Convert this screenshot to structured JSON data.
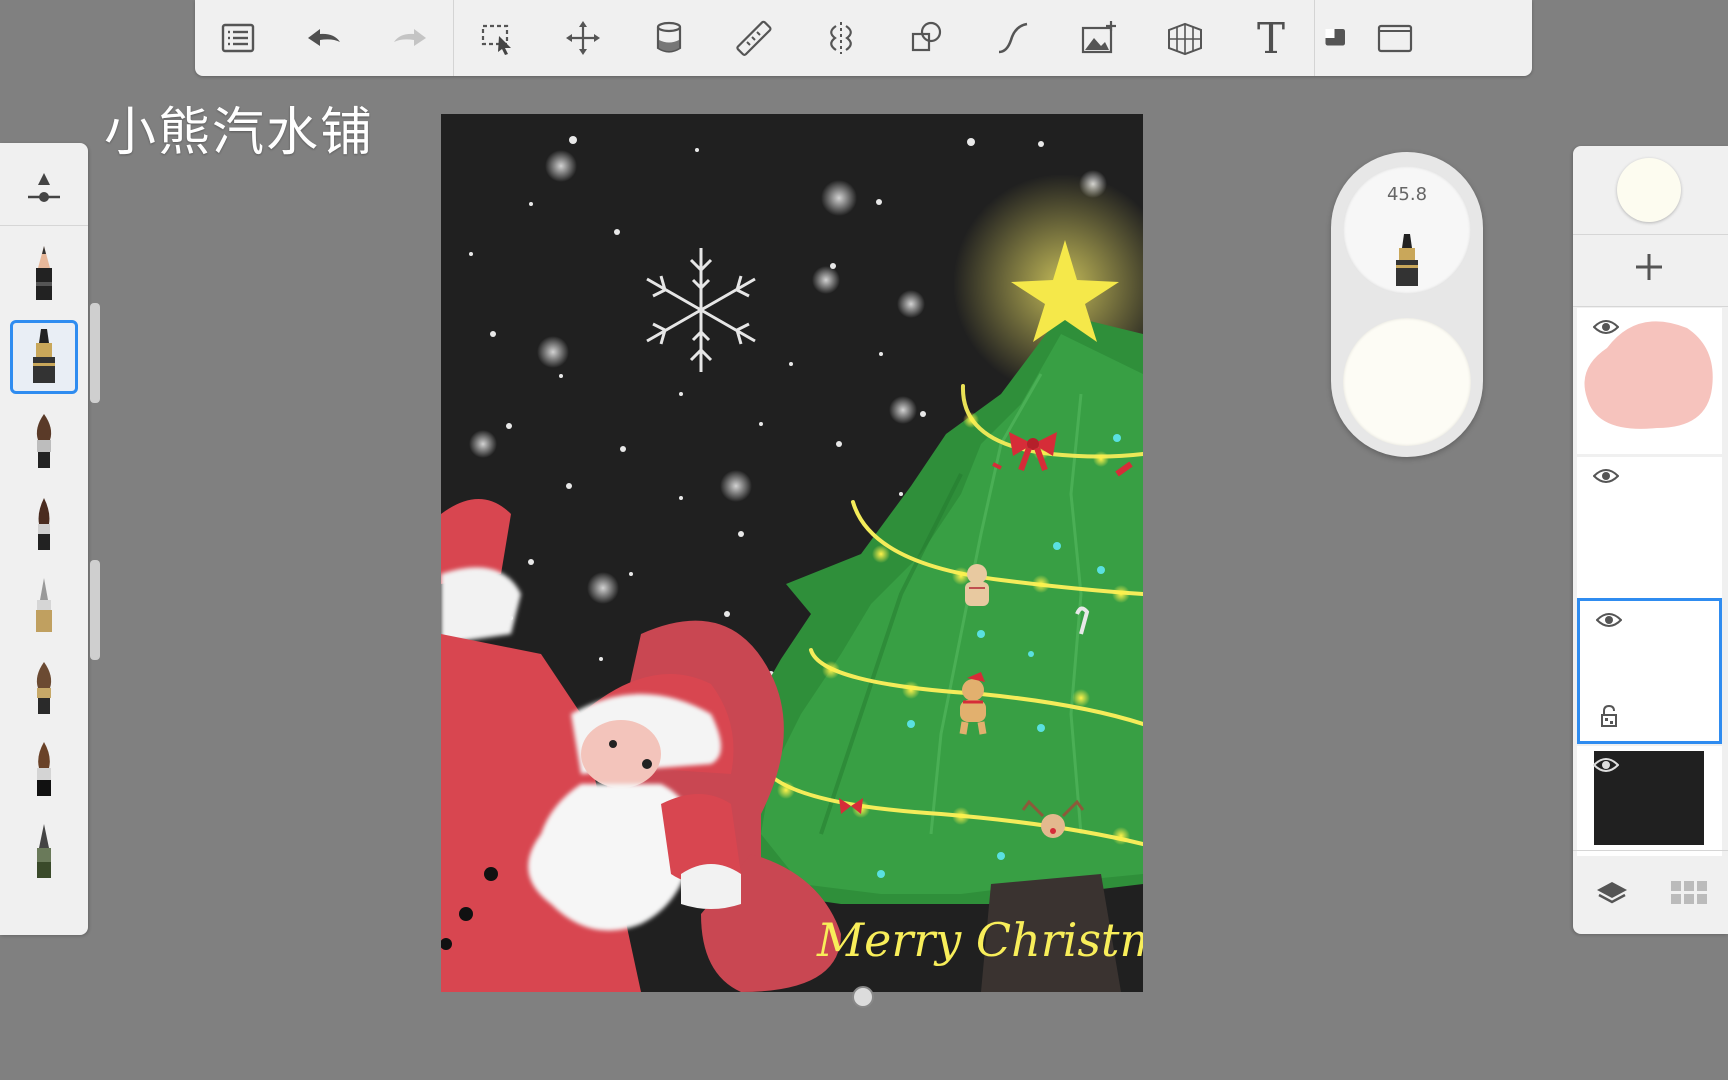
{
  "watermark": "小熊汽水铺",
  "toolbar": {
    "items": [
      {
        "name": "gallery-menu-icon"
      },
      {
        "name": "undo-icon"
      },
      {
        "name": "redo-icon"
      },
      {
        "name": "selection-tool-icon"
      },
      {
        "name": "transform-move-icon"
      },
      {
        "name": "fill-bucket-icon"
      },
      {
        "name": "ruler-icon"
      },
      {
        "name": "symmetry-icon"
      },
      {
        "name": "shapes-icon"
      },
      {
        "name": "curve-icon"
      },
      {
        "name": "import-image-icon"
      },
      {
        "name": "perspective-grid-icon"
      },
      {
        "name": "text-tool-icon",
        "glyph": "T"
      },
      {
        "name": "reference-icon"
      },
      {
        "name": "fullscreen-icon"
      }
    ]
  },
  "brushes": [
    {
      "name": "brush-settings-icon"
    },
    {
      "name": "pencil-brush"
    },
    {
      "name": "marker-brush",
      "active": true
    },
    {
      "name": "paint-brush-round"
    },
    {
      "name": "ink-brush"
    },
    {
      "name": "technical-pen-brush"
    },
    {
      "name": "watercolor-brush"
    },
    {
      "name": "calligraphy-brush"
    },
    {
      "name": "fineliner-brush"
    }
  ],
  "puck": {
    "size_value": "45.8",
    "color": "#fdfcf5"
  },
  "colors": {
    "accent": "#2f8cf0",
    "canvas_bg": "#202020",
    "tree_green": "#2f8f3a",
    "santa_red": "#d84650",
    "star_yellow": "#f5e84a",
    "current_color": "#fdfcf0"
  },
  "layers": [
    {
      "name": "layer-1",
      "thumbnail": "pink-blob",
      "visible": true
    },
    {
      "name": "layer-2",
      "thumbnail": "blank",
      "visible": true
    },
    {
      "name": "layer-3",
      "thumbnail": "blank",
      "visible": true,
      "selected": true,
      "locked": true
    },
    {
      "name": "layer-4",
      "thumbnail": "black",
      "visible": true
    }
  ],
  "artwork": {
    "caption": "Merry Christmas"
  }
}
